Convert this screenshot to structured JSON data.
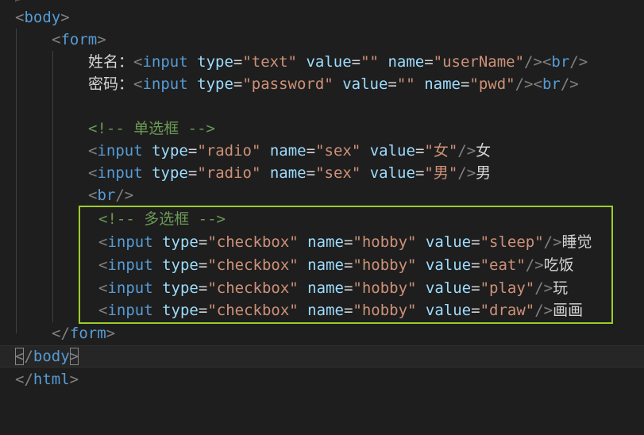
{
  "lines": [
    {
      "id": "body-open",
      "text": "<body>"
    },
    {
      "id": "form-open",
      "text": "<form>"
    },
    {
      "id": "username",
      "label": "姓名：",
      "tag": "input",
      "attrs": [
        {
          "name": "type",
          "value": "\"text\""
        },
        {
          "name": "value",
          "value": "\"\""
        },
        {
          "name": "name",
          "value": "\"userName\""
        }
      ],
      "close": "/>",
      "tail_tag": "br"
    },
    {
      "id": "password",
      "label": "密码：",
      "tag": "input",
      "attrs": [
        {
          "name": "type",
          "value": "\"password\""
        },
        {
          "name": "value",
          "value": "\"\""
        },
        {
          "name": "name",
          "value": "\"pwd\""
        }
      ],
      "close": "/>",
      "tail_tag": "br"
    },
    {
      "id": "comment-radio",
      "text": "<!-- 单选框 -->"
    },
    {
      "id": "radio-female",
      "tag": "input",
      "attrs": [
        {
          "name": "type",
          "value": "\"radio\""
        },
        {
          "name": "name",
          "value": "\"sex\""
        },
        {
          "name": "value",
          "value": "\"女\""
        }
      ],
      "close": "/>",
      "trail": "女"
    },
    {
      "id": "radio-male",
      "tag": "input",
      "attrs": [
        {
          "name": "type",
          "value": "\"radio\""
        },
        {
          "name": "name",
          "value": "\"sex\""
        },
        {
          "name": "value",
          "value": "\"男\""
        }
      ],
      "close": "/>",
      "trail": "男"
    },
    {
      "id": "br",
      "tag": "br"
    },
    {
      "id": "comment-checkbox",
      "text": "<!-- 多选框 -->"
    },
    {
      "id": "cb-sleep",
      "tag": "input",
      "attrs": [
        {
          "name": "type",
          "value": "\"checkbox\""
        },
        {
          "name": "name",
          "value": "\"hobby\""
        },
        {
          "name": "value",
          "value": "\"sleep\""
        }
      ],
      "close": "/>",
      "trail": "睡觉"
    },
    {
      "id": "cb-eat",
      "tag": "input",
      "attrs": [
        {
          "name": "type",
          "value": "\"checkbox\""
        },
        {
          "name": "name",
          "value": "\"hobby\""
        },
        {
          "name": "value",
          "value": "\"eat\""
        }
      ],
      "close": "/>",
      "trail": "吃饭"
    },
    {
      "id": "cb-play",
      "tag": "input",
      "attrs": [
        {
          "name": "type",
          "value": "\"checkbox\""
        },
        {
          "name": "name",
          "value": "\"hobby\""
        },
        {
          "name": "value",
          "value": "\"play\""
        }
      ],
      "close": "/>",
      "trail": "玩"
    },
    {
      "id": "cb-draw",
      "tag": "input",
      "attrs": [
        {
          "name": "type",
          "value": "\"checkbox\""
        },
        {
          "name": "name",
          "value": "\"hobby\""
        },
        {
          "name": "value",
          "value": "\"draw\""
        }
      ],
      "close": "/>",
      "trail": "画画"
    },
    {
      "id": "form-close",
      "text": "</form>"
    },
    {
      "id": "body-close",
      "text": "</body>"
    },
    {
      "id": "html-close",
      "text": "</html>"
    }
  ],
  "theme": {
    "background": "#1e1e1e",
    "tag": "#569cd6",
    "attribute": "#9cdcfe",
    "string": "#ce9178",
    "punctuation": "#808080",
    "comment": "#6a9955",
    "selection_box": "#9ccc2c"
  }
}
